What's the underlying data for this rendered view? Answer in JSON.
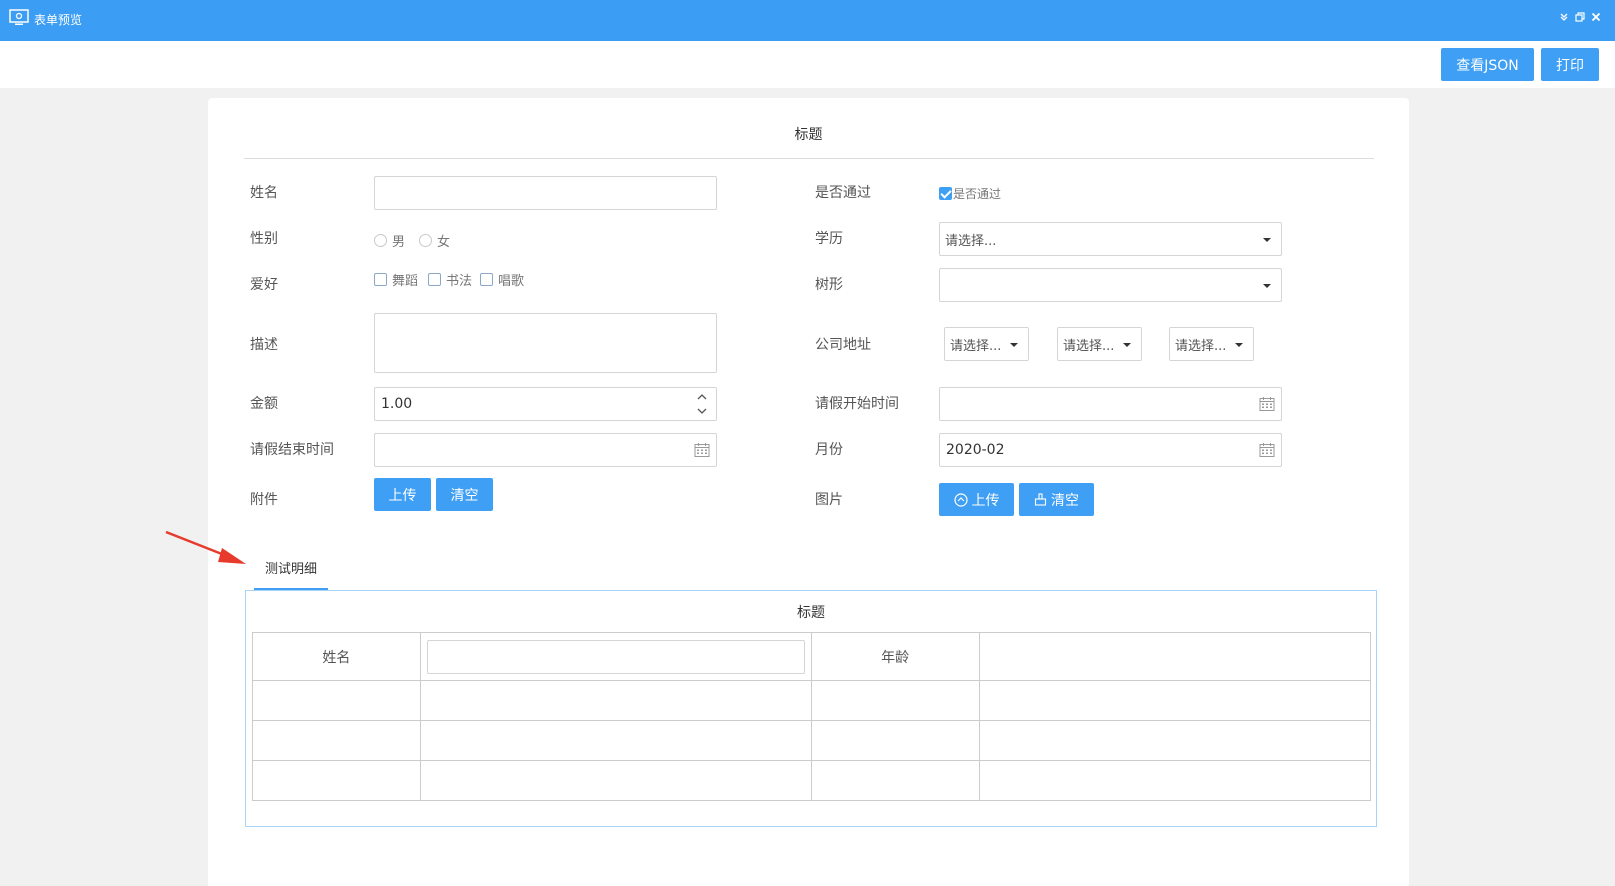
{
  "window": {
    "title": "表单预览",
    "controls": [
      "collapse-icon",
      "restore-icon",
      "close-icon"
    ]
  },
  "toolbar": {
    "view_json_label": "查看JSON",
    "print_label": "打印"
  },
  "form": {
    "title": "标题",
    "name": {
      "label": "姓名",
      "value": ""
    },
    "passed": {
      "label": "是否通过",
      "option": "是否通过",
      "checked": true
    },
    "gender": {
      "label": "性别",
      "options": [
        "男",
        "女"
      ]
    },
    "education": {
      "label": "学历",
      "placeholder": "请选择..."
    },
    "hobby": {
      "label": "爱好",
      "options": [
        "舞蹈",
        "书法",
        "唱歌"
      ]
    },
    "tree": {
      "label": "树形",
      "value": ""
    },
    "description": {
      "label": "描述",
      "value": ""
    },
    "company_address": {
      "label": "公司地址",
      "placeholders": [
        "请选择...",
        "请选择...",
        "请选择..."
      ]
    },
    "amount": {
      "label": "金额",
      "value": "1.00"
    },
    "leave_start": {
      "label": "请假开始时间",
      "value": ""
    },
    "leave_end": {
      "label": "请假结束时间",
      "value": ""
    },
    "month": {
      "label": "月份",
      "value": "2020-02"
    },
    "attachment": {
      "label": "附件",
      "upload_label": "上传",
      "clear_label": "清空"
    },
    "image": {
      "label": "图片",
      "upload_label": "上传",
      "clear_label": "清空"
    }
  },
  "detail": {
    "tab_label": "测试明细",
    "title": "标题",
    "columns": [
      "姓名",
      "年龄"
    ],
    "empty_rows": 3
  },
  "colors": {
    "titlebar": "#3c9df5",
    "primary": "#3e9ff5",
    "annotation_arrow": "#e8392d"
  }
}
